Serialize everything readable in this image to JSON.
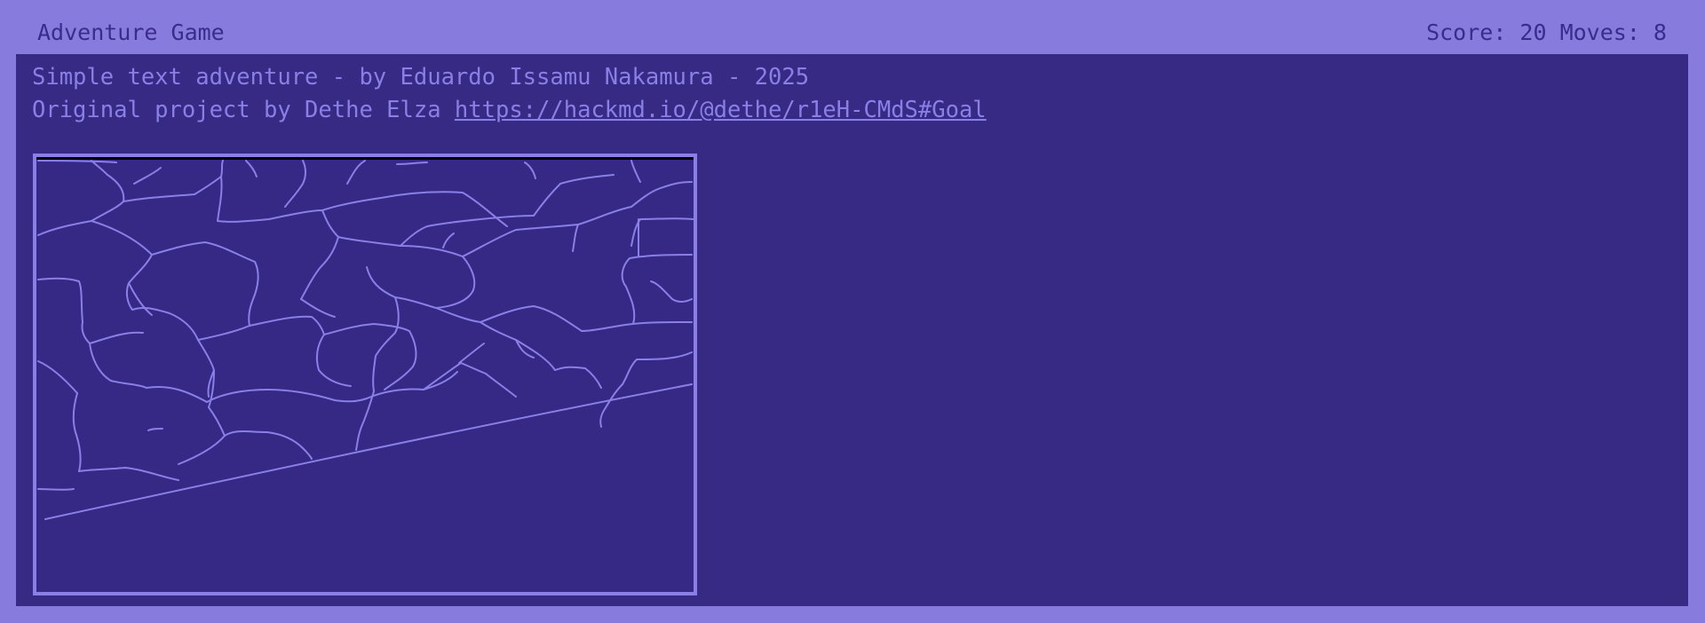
{
  "window": {
    "title": "Adventure Game",
    "status": "Score: 20 Moves: 8"
  },
  "intro": {
    "line1": "Simple text adventure - by Eduardo Issamu Nakamura - 2025",
    "line2_prefix": "Original project by Dethe Elza ",
    "link_text": "https://hackmd.io/@dethe/r1eH-CMdS#Goal"
  },
  "scene": {
    "icon": "stone-wall-icon"
  },
  "colors": {
    "background": "#877bde",
    "screen": "#372a84",
    "text": "#8a7fe6"
  }
}
